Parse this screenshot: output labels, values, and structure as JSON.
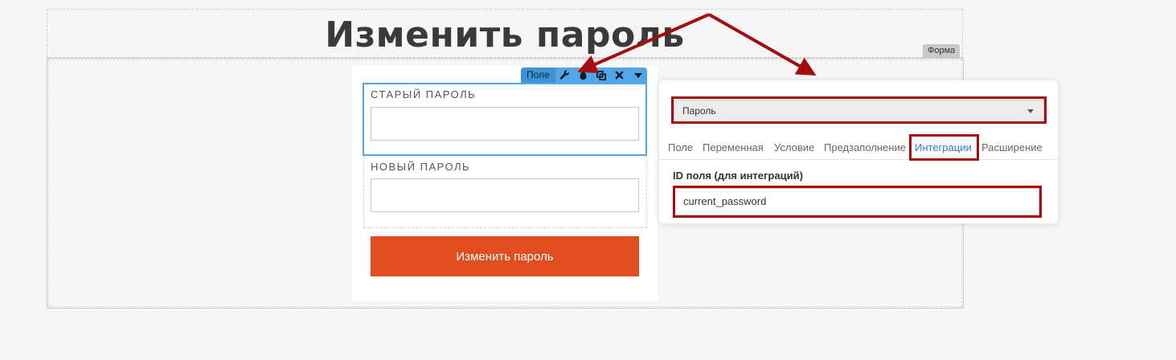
{
  "page": {
    "title": "Изменить пароль"
  },
  "form_block": {
    "tag_label": "Форма"
  },
  "field_toolbar": {
    "label": "Поле",
    "tools": [
      "wrench-icon",
      "drop-icon",
      "copy-icon",
      "close-icon",
      "chevron-down-icon"
    ]
  },
  "form": {
    "fields": [
      {
        "label": "СТАРЫЙ ПАРОЛЬ",
        "value": ""
      },
      {
        "label": "НОВЫЙ ПАРОЛЬ",
        "value": ""
      }
    ],
    "submit_label": "Изменить пароль"
  },
  "settings_panel": {
    "field_type": "Пароль",
    "tabs": [
      {
        "label": "Поле",
        "active": false
      },
      {
        "label": "Переменная",
        "active": false
      },
      {
        "label": "Условие",
        "active": false
      },
      {
        "label": "Предзаполнение",
        "active": false
      },
      {
        "label": "Интеграции",
        "active": true
      },
      {
        "label": "Расширение",
        "active": false
      }
    ],
    "id_label": "ID поля (для интеграций)",
    "id_value": "current_password"
  },
  "colors": {
    "accent": "#52a7e8",
    "button": "#e04e1f",
    "highlight": "#a30d0d",
    "active_tab": "#2d78d6"
  }
}
